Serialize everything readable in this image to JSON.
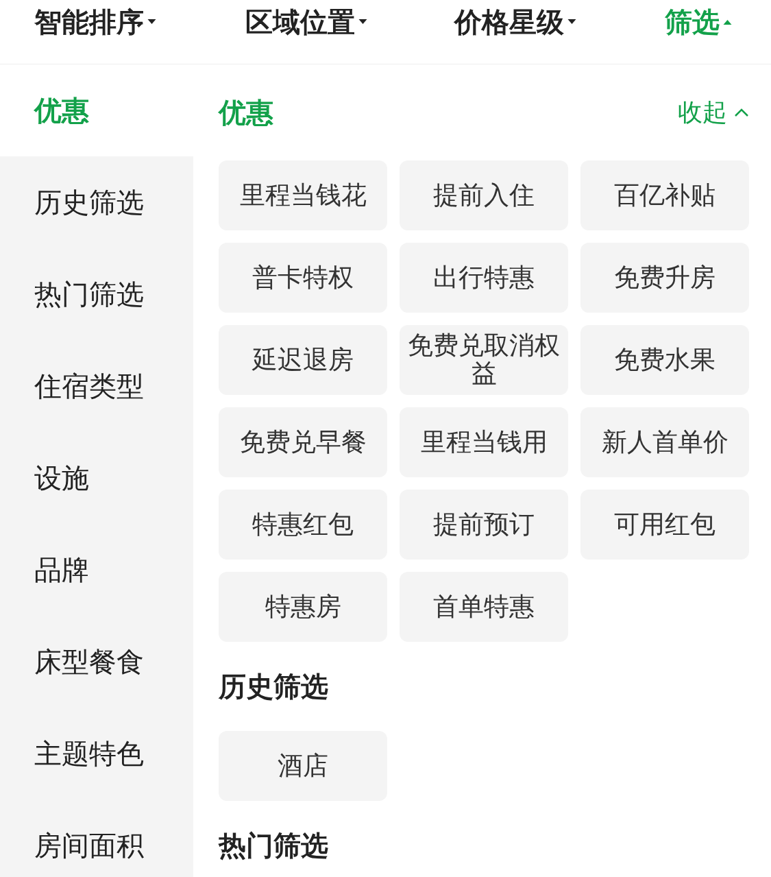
{
  "tabs": [
    {
      "label": "智能排序",
      "selected": false,
      "expanded": false
    },
    {
      "label": "区域位置",
      "selected": false,
      "expanded": false
    },
    {
      "label": "价格星级",
      "selected": false,
      "expanded": false
    },
    {
      "label": "筛选",
      "selected": true,
      "expanded": true
    }
  ],
  "sidebar": {
    "items": [
      {
        "label": "优惠",
        "selected": true
      },
      {
        "label": "历史筛选",
        "selected": false
      },
      {
        "label": "热门筛选",
        "selected": false
      },
      {
        "label": "住宿类型",
        "selected": false
      },
      {
        "label": "设施",
        "selected": false
      },
      {
        "label": "品牌",
        "selected": false
      },
      {
        "label": "床型餐食",
        "selected": false
      },
      {
        "label": "主题特色",
        "selected": false
      },
      {
        "label": "房间面积",
        "selected": false
      }
    ]
  },
  "sections": [
    {
      "title": "优惠",
      "selected": true,
      "collapse_label": "收起",
      "options": [
        "里程当钱花",
        "提前入住",
        "百亿补贴",
        "普卡特权",
        "出行特惠",
        "免费升房",
        "延迟退房",
        "免费兑取消权益",
        "免费水果",
        "免费兑早餐",
        "里程当钱用",
        "新人首单价",
        "特惠红包",
        "提前预订",
        "可用红包",
        "特惠房",
        "首单特惠"
      ]
    },
    {
      "title": "历史筛选",
      "selected": false,
      "options": [
        "酒店"
      ]
    },
    {
      "title": "热门筛选",
      "selected": false
    }
  ]
}
